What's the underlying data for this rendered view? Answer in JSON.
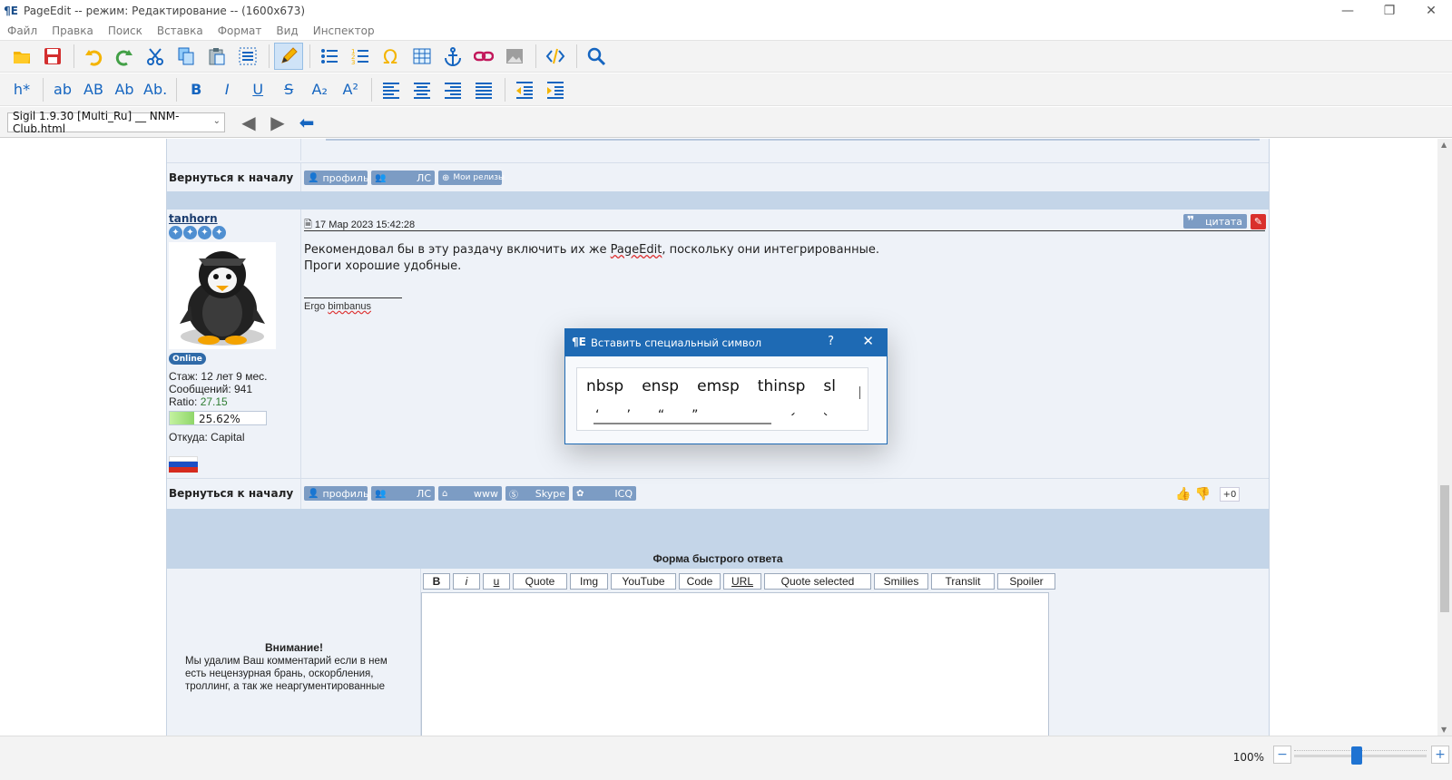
{
  "window": {
    "title": "PageEdit -- режим: Редактирование -- (1600x673)",
    "logo": "¶E",
    "minimize": "—",
    "maximize": "❐",
    "close": "✕"
  },
  "menu": [
    "Файл",
    "Правка",
    "Поиск",
    "Вставка",
    "Формат",
    "Вид",
    "Инспектор"
  ],
  "toolbar2": {
    "heading": "h*",
    "case": [
      "ab",
      "AB",
      "Ab",
      "Ab."
    ],
    "bold": "B",
    "italic": "I",
    "underline": "U",
    "strike": "S",
    "sub": "A₂",
    "sup": "A²"
  },
  "toolbar3": {
    "file_combo": "Sigil 1.9.30 [Multi_Ru] __ NNM-Club.html",
    "back": "◀",
    "forward": "▶",
    "return": "⬅"
  },
  "forum": {
    "back_to_top": "Вернуться к началу",
    "btn_profile": "профиль",
    "btn_pm": "ЛС",
    "btn_releases": "Мои релизы",
    "btn_www": "www",
    "btn_skype": "Skype",
    "btn_icq": "ICQ",
    "post": {
      "username": "tanhorn",
      "online": "Online",
      "stazh": "Стаж: 12 лет 9 мес.",
      "messages": "Сообщений: 941",
      "ratio_label": "Ratio: ",
      "ratio_value": "27.15",
      "progress_text": "25.62%",
      "progress_value": 25.62,
      "from": "Откуда: Capital",
      "date": "17 Мар 2023 15:42:28",
      "quote_btn": "цитата",
      "body_line1_a": "Рекомендовал бы в эту раздачу включить их же ",
      "body_line1_link": "PageEdit",
      "body_line1_b": ", поскольку они интегрированные.",
      "body_line2": "Проги хорошие удобные.",
      "signature_a": "Ergo ",
      "signature_b": "bimbanus",
      "vote_count": "+0"
    },
    "quick_reply": {
      "title": "Форма быстрого ответа",
      "buttons": [
        "B",
        "i",
        "u",
        "Quote",
        "Img",
        "YouTube",
        "Code",
        "URL",
        "Quote selected",
        "Smilies",
        "Translit",
        "Spoiler"
      ],
      "warn_title": "Внимание!",
      "warn_text": "Мы удалим Ваш комментарий если в нем есть нецензурная брань, оскорбления, троллинг, а так же неаргументированные"
    }
  },
  "dialog": {
    "title": "Вставить специальный символ",
    "help": "?",
    "close": "✕",
    "symbols": [
      "nbsp",
      "ensp",
      "emsp",
      "thinsp",
      "sl"
    ],
    "symbols2": [
      "‘",
      "’",
      "“",
      "”",
      ",",
      "„",
      "‹",
      "›"
    ]
  },
  "status": {
    "zoom": "100%",
    "zoom_minus": "−",
    "zoom_plus": "+",
    "zoom_level": 0.47
  }
}
